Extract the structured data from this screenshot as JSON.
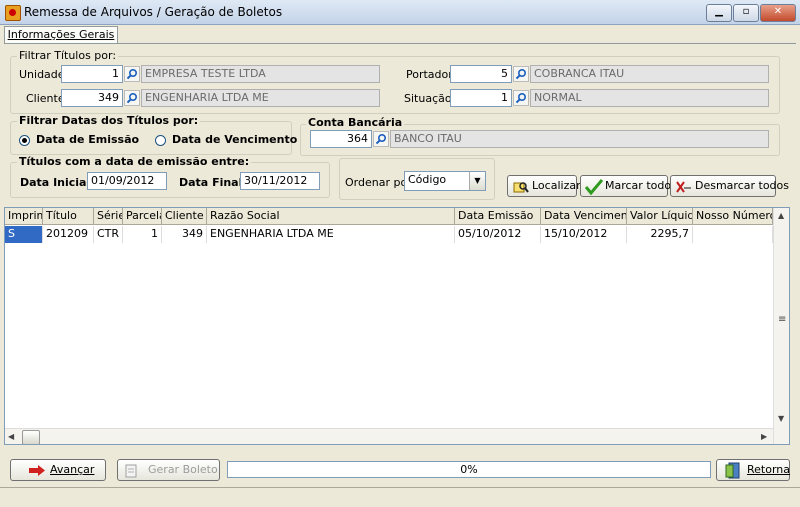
{
  "window": {
    "title": "Remessa de Arquivos / Geração de Boletos"
  },
  "tabs": [
    {
      "label": "Informações Gerais"
    }
  ],
  "filter": {
    "legend": "Filtrar Títulos por:",
    "unidade": {
      "label": "Unidade",
      "code": "1",
      "name": "EMPRESA TESTE LTDA"
    },
    "cliente": {
      "label": "Cliente",
      "code": "349",
      "name": "ENGENHARIA LTDA ME"
    },
    "portador": {
      "label": "Portador",
      "code": "5",
      "name": "COBRANCA ITAU"
    },
    "situacao": {
      "label": "Situação",
      "code": "1",
      "name": "NORMAL"
    }
  },
  "date_filter": {
    "legend": "Filtrar Datas dos Títulos por:",
    "options": [
      {
        "label": "Data de Emissão",
        "selected": true
      },
      {
        "label": "Data de Vencimento",
        "selected": false
      }
    ]
  },
  "conta": {
    "legend": "Conta Bancária",
    "code": "364",
    "name": "BANCO ITAU"
  },
  "range": {
    "legend": "Títulos com a data de emissão entre:",
    "inicial_label": "Data Inicial",
    "inicial_value": "01/09/2012",
    "final_label": "Data Final",
    "final_value": "30/11/2012"
  },
  "order": {
    "label": "Ordenar por:",
    "value": "Código"
  },
  "actions": {
    "localizar": "Localizar",
    "marcar": "Marcar todos",
    "desmarcar": "Desmarcar todos"
  },
  "table": {
    "columns": [
      "Imprimir",
      "Título",
      "Série",
      "Parcela",
      "Cliente",
      "Razão Social",
      "Data Emissão",
      "Data Vencimento",
      "Valor Líquido",
      "Nosso Número"
    ],
    "rows": [
      [
        "S",
        "201209",
        "CTR",
        "1",
        "349",
        "ENGENHARIA LTDA ME",
        "05/10/2012",
        "15/10/2012",
        "2295,7",
        ""
      ]
    ]
  },
  "footer": {
    "avancar": "Avançar",
    "gerar": "Gerar Boleto",
    "progress": "0%",
    "retorna": "Retorna"
  },
  "colors": {
    "accent": "#316ac5",
    "window_bg": "#ece9d8"
  }
}
